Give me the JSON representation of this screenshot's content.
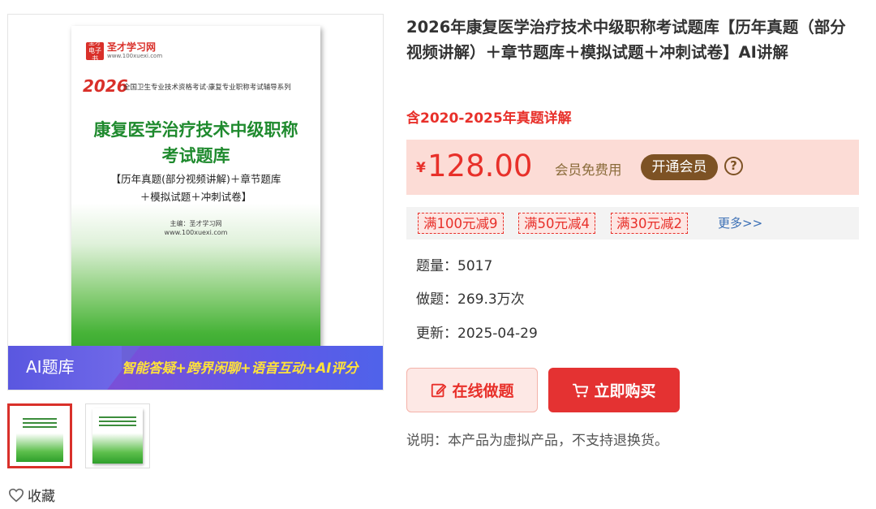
{
  "gallery": {
    "cover": {
      "logo_mark": "圣才\n电子书",
      "logo_name": "圣才学习网",
      "logo_url": "www.100xuexi.com",
      "year": "2026",
      "series": "全国卫生专业技术资格考试·康复专业职称考试辅导系列",
      "title_line1": "康复医学治疗技术中级职称",
      "title_line2": "考试题库",
      "sub_line1": "【历年真题(部分视频讲解)＋章节题库",
      "sub_line2": "＋模拟试题＋冲刺试卷】",
      "editor": "主编：圣才学习网",
      "editor_url": "www.100xuexi.com"
    },
    "banner": {
      "label": "AI题库",
      "slogan": "智能答疑+跨界闲聊+语音互动+AI评分"
    },
    "favorite_label": "收藏"
  },
  "product": {
    "title": "2026年康复医学治疗技术中级职称考试题库【历年真题（部分视频讲解）＋章节题库＋模拟试题＋冲刺试卷】AI讲解",
    "subtitle": "含2020-2025年真题详解",
    "price": {
      "currency": "¥",
      "value": "128.00",
      "member_text": "会员免费用",
      "member_button": "开通会员",
      "help": "?"
    },
    "coupons": [
      "满100元减9",
      "满50元减4",
      "满30元减2"
    ],
    "coupons_more": "更多>>",
    "stats": [
      {
        "label": "题量：",
        "value": "5017"
      },
      {
        "label": "做题：",
        "value": "269.3万次"
      },
      {
        "label": "更新：",
        "value": "2025-04-29"
      }
    ],
    "actions": {
      "practice": "在线做题",
      "buy": "立即购买"
    },
    "note": "说明：本产品为虚拟产品，不支持退换货。"
  },
  "colors": {
    "accent_red": "#e8302a",
    "price_bg": "#fcdcd6",
    "member_brown": "#7d5224",
    "cover_green": "#1f8a2e"
  }
}
